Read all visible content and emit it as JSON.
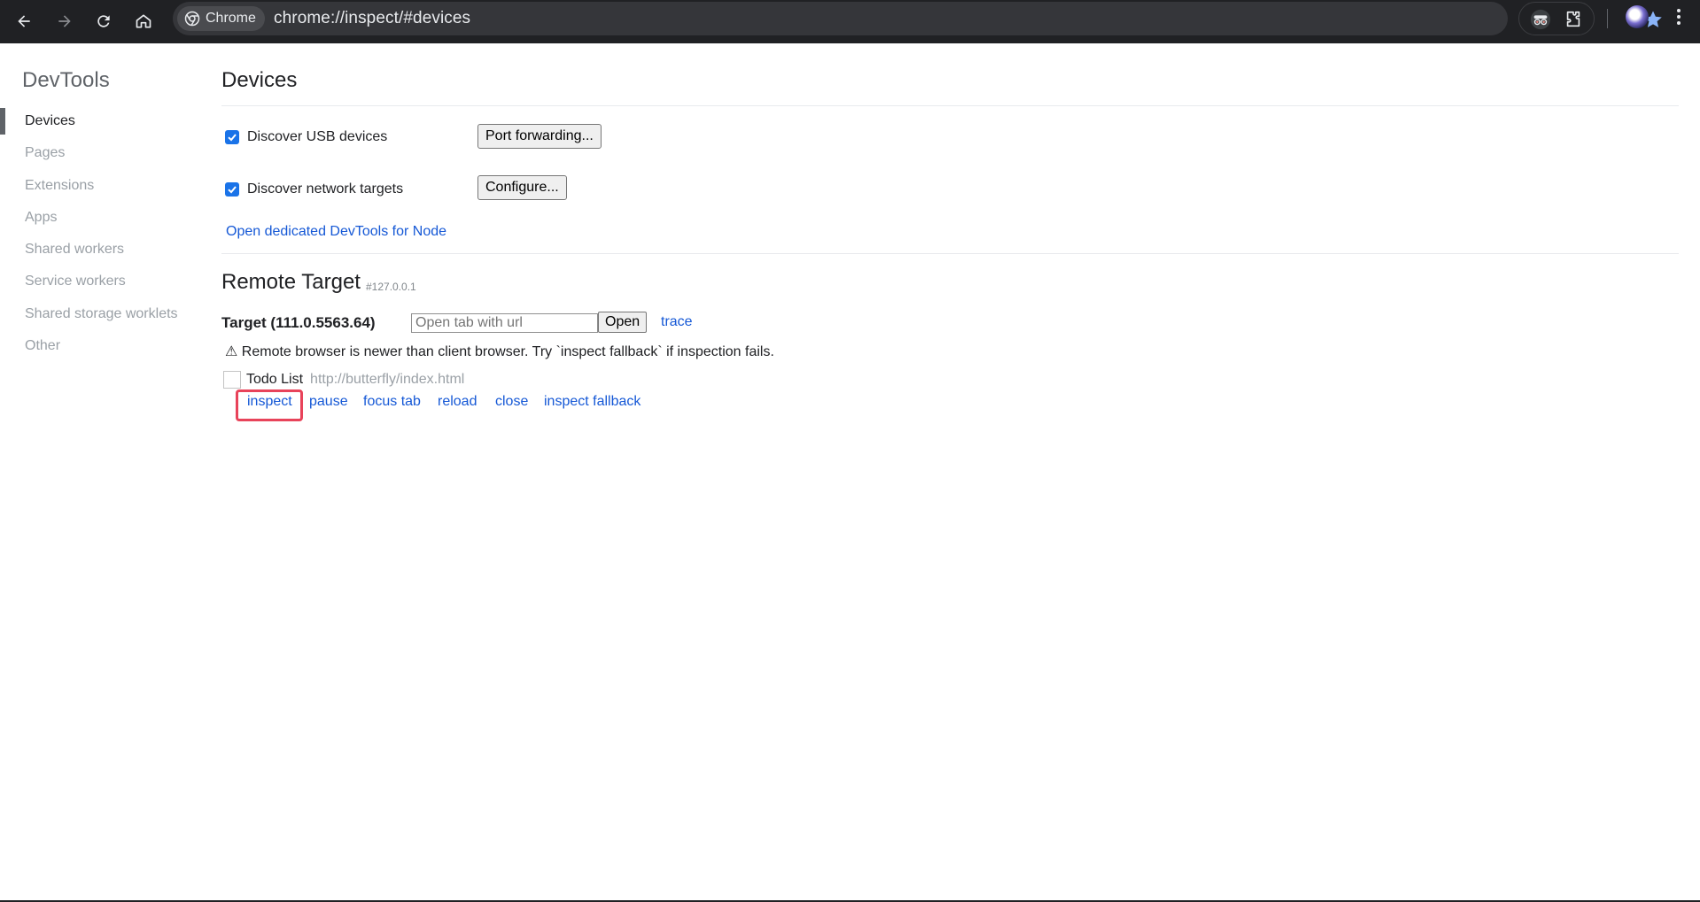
{
  "browser": {
    "chip_label": "Chrome",
    "url": "chrome://inspect/#devices"
  },
  "sidebar": {
    "title": "DevTools",
    "items": [
      {
        "label": "Devices",
        "active": true
      },
      {
        "label": "Pages"
      },
      {
        "label": "Extensions"
      },
      {
        "label": "Apps"
      },
      {
        "label": "Shared workers"
      },
      {
        "label": "Service workers"
      },
      {
        "label": "Shared storage worklets"
      },
      {
        "label": "Other"
      }
    ]
  },
  "devices": {
    "title": "Devices",
    "usb": {
      "label": "Discover USB devices",
      "checked": true,
      "button": "Port forwarding..."
    },
    "network": {
      "label": "Discover network targets",
      "checked": true,
      "button": "Configure..."
    },
    "node_link": "Open dedicated DevTools for Node"
  },
  "remote": {
    "title": "Remote Target",
    "ip": "#127.0.0.1",
    "target_name": "Target (111.0.5563.64)",
    "url_placeholder": "Open tab with url",
    "open_button": "Open",
    "trace_link": "trace",
    "warning": "⚠ Remote browser is newer than client browser. Try `inspect fallback` if inspection fails.",
    "page": {
      "title": "Todo List",
      "url": "http://butterfly/index.html",
      "actions": [
        "inspect",
        "pause",
        "focus tab",
        "reload",
        "close",
        "inspect fallback"
      ]
    }
  },
  "colors": {
    "toolbar_bg": "#202124",
    "omnibox_bg": "#35363a",
    "link": "#1558d6",
    "highlight": "#e8435a",
    "checkbox": "#1a73e8"
  }
}
